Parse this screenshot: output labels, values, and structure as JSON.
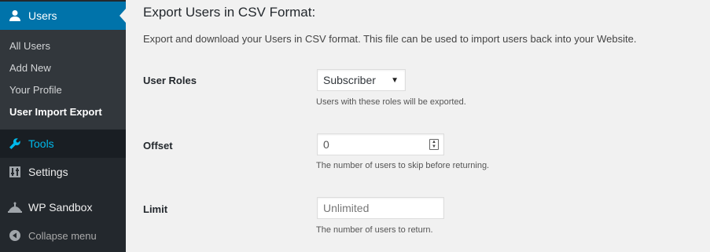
{
  "sidebar": {
    "users": {
      "label": "Users",
      "icon": "user-icon"
    },
    "submenu": [
      {
        "label": "All Users"
      },
      {
        "label": "Add New"
      },
      {
        "label": "Your Profile"
      },
      {
        "label": "User Import Export",
        "current": true
      }
    ],
    "tools": {
      "label": "Tools",
      "icon": "wrench-icon"
    },
    "settings": {
      "label": "Settings",
      "icon": "settings-sliders-icon"
    },
    "sandbox": {
      "label": "WP Sandbox",
      "icon": "sandbox-icon"
    },
    "collapse": {
      "label": "Collapse menu",
      "icon": "collapse-arrow-icon"
    },
    "colors": {
      "background": "#23282d",
      "active": "#0073aa",
      "submenu": "#32373c",
      "tools_text": "#00b9eb"
    }
  },
  "page": {
    "title": "Export Users in CSV Format:",
    "description": "Export and download your Users in CSV format. This file can be used to import users back into your Website."
  },
  "form": {
    "roles": {
      "label": "User Roles",
      "selected": "Subscriber",
      "help": "Users with these roles will be exported."
    },
    "offset": {
      "label": "Offset",
      "value": "0",
      "help": "The number of users to skip before returning."
    },
    "limit": {
      "label": "Limit",
      "placeholder": "Unlimited",
      "help": "The number of users to return."
    }
  }
}
